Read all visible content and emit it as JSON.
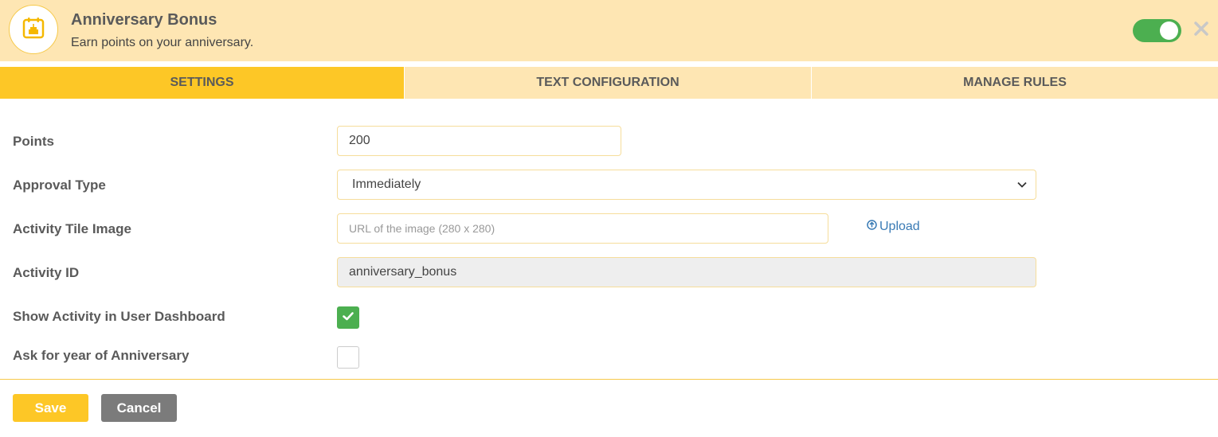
{
  "header": {
    "title": "Anniversary Bonus",
    "subtitle": "Earn points on your anniversary.",
    "icon": "calendar-cake-icon",
    "enabled": true,
    "accent": "#fdc726",
    "toggle_color": "#4caf50"
  },
  "tabs": [
    {
      "label": "SETTINGS",
      "active": true
    },
    {
      "label": "TEXT CONFIGURATION",
      "active": false
    },
    {
      "label": "MANAGE RULES",
      "active": false
    }
  ],
  "form": {
    "points": {
      "label": "Points",
      "value": "200"
    },
    "approval_type": {
      "label": "Approval Type",
      "value": "Immediately"
    },
    "activity_tile_image": {
      "label": "Activity Tile Image",
      "placeholder": "URL of the image (280 x 280)",
      "upload_label": "Upload"
    },
    "activity_id": {
      "label": "Activity ID",
      "value": "anniversary_bonus"
    },
    "show_in_dashboard": {
      "label": "Show Activity in User Dashboard",
      "checked": true
    },
    "ask_year": {
      "label": "Ask for year of Anniversary",
      "checked": false
    }
  },
  "footer": {
    "save_label": "Save",
    "cancel_label": "Cancel"
  }
}
